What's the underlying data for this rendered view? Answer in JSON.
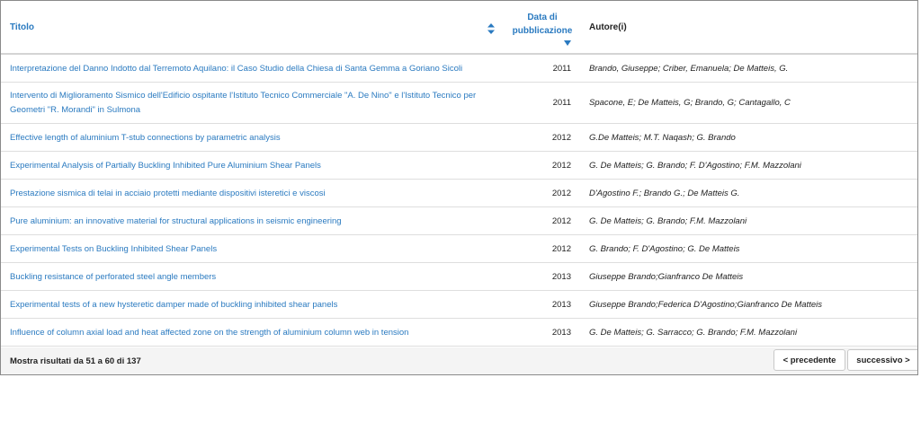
{
  "table": {
    "headers": {
      "title": "Titolo",
      "date_line1": "Data di",
      "date_line2": "pubblicazione",
      "authors": "Autore(i)"
    },
    "rows": [
      {
        "title": "Interpretazione del Danno Indotto dal Terremoto Aquilano: il Caso Studio della Chiesa di Santa Gemma a Goriano Sicoli",
        "year": "2011",
        "authors": "Brando, Giuseppe; Criber, Emanuela; De Matteis, G."
      },
      {
        "title": "Intervento di Miglioramento Sismico dell'Edificio ospitante l'Istituto Tecnico Commerciale \"A. De Nino\" e l'Istituto Tecnico per Geometri \"R. Morandi\" in Sulmona",
        "year": "2011",
        "authors": "Spacone, E; De Matteis, G; Brando, G; Cantagallo, C"
      },
      {
        "title": "Effective length of aluminium T-stub connections by parametric analysis",
        "year": "2012",
        "authors": "G.De Matteis; M.T. Naqash; G. Brando"
      },
      {
        "title": "Experimental Analysis of Partially Buckling Inhibited Pure Aluminium Shear Panels",
        "year": "2012",
        "authors": "G. De Matteis; G. Brando; F. D'Agostino; F.M. Mazzolani"
      },
      {
        "title": "Prestazione sismica di telai in acciaio protetti mediante dispositivi isteretici e viscosi",
        "year": "2012",
        "authors": "D'Agostino F.; Brando G.; De Matteis G."
      },
      {
        "title": "Pure aluminium: an innovative material for structural applications in seismic engineering",
        "year": "2012",
        "authors": "G. De Matteis; G. Brando; F.M. Mazzolani"
      },
      {
        "title": "Experimental Tests on Buckling Inhibited Shear Panels",
        "year": "2012",
        "authors": "G. Brando; F. D'Agostino; G. De Matteis"
      },
      {
        "title": "Buckling resistance of perforated steel angle members",
        "year": "2013",
        "authors": "Giuseppe Brando;Gianfranco De Matteis"
      },
      {
        "title": "Experimental tests of a new hysteretic damper made of buckling inhibited shear panels",
        "year": "2013",
        "authors": "Giuseppe Brando;Federica D'Agostino;Gianfranco De Matteis"
      },
      {
        "title": "Influence of column axial load and heat affected zone on the strength of aluminium column web in tension",
        "year": "2013",
        "authors": "G. De Matteis; G. Sarracco; G. Brando; F.M. Mazzolani"
      }
    ]
  },
  "footer": {
    "showing": "Mostra risultati da 51 a 60 di 137",
    "prev_label": "< precedente",
    "next_label": "successivo >"
  },
  "colors": {
    "link": "#2a7ac0",
    "footer_bg": "#f4f4f4"
  }
}
